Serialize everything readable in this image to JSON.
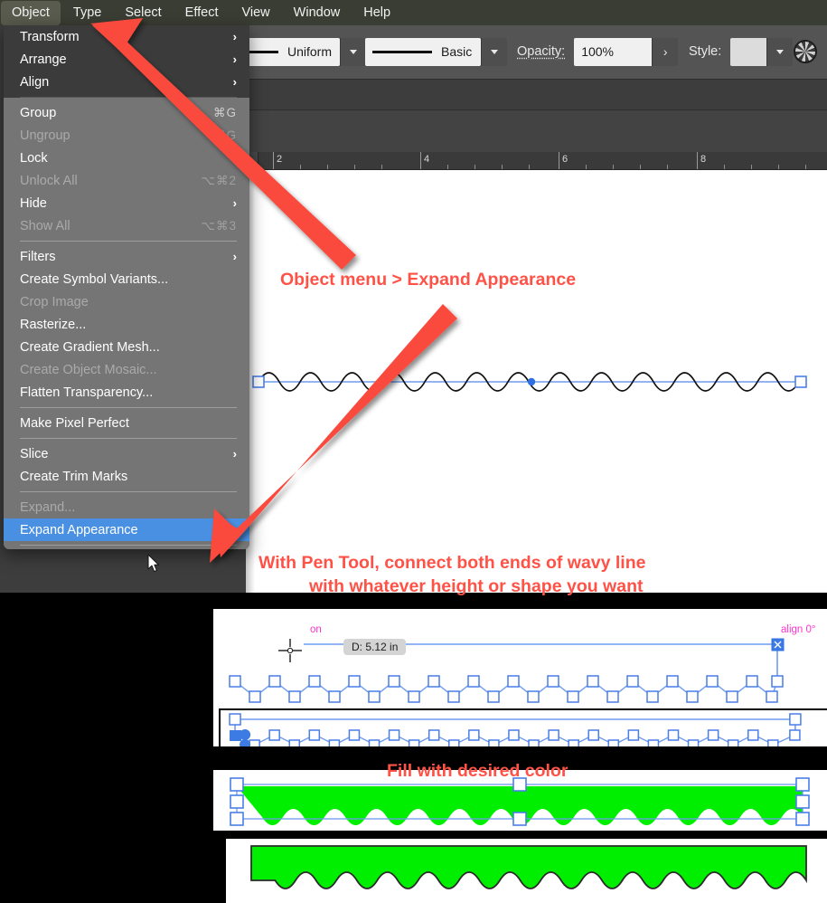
{
  "app": {
    "menubar": [
      {
        "label": "Object",
        "active": true
      },
      {
        "label": "Type",
        "active": false
      },
      {
        "label": "Select",
        "active": false
      },
      {
        "label": "Effect",
        "active": false
      },
      {
        "label": "View",
        "active": false
      },
      {
        "label": "Window",
        "active": false
      },
      {
        "label": "Help",
        "active": false
      }
    ]
  },
  "options_bar": {
    "stroke_profile": "Uniform",
    "brush_definition": "Basic",
    "opacity_label": "Opacity:",
    "opacity_value": "100%",
    "style_label": "Style:",
    "style_swatch_color": "#dcdcdc"
  },
  "ruler": {
    "unit_labels": [
      "2",
      "4",
      "6",
      "8"
    ]
  },
  "object_menu": {
    "items": [
      {
        "label": "Transform",
        "shortcut": "",
        "enabled": true,
        "submenu": true,
        "selected": false,
        "dark": true
      },
      {
        "label": "Arrange",
        "shortcut": "",
        "enabled": true,
        "submenu": true,
        "selected": false,
        "dark": true
      },
      {
        "label": "Align",
        "shortcut": "",
        "enabled": true,
        "submenu": true,
        "selected": false,
        "dark": true
      },
      {
        "separator": true,
        "dark": true
      },
      {
        "label": "Group",
        "shortcut": "⌘G",
        "enabled": true,
        "submenu": false,
        "selected": false
      },
      {
        "label": "Ungroup",
        "shortcut": "⌘G",
        "enabled": false,
        "submenu": false,
        "selected": false
      },
      {
        "label": "Lock",
        "shortcut": "",
        "enabled": true,
        "submenu": false,
        "selected": false
      },
      {
        "label": "Unlock All",
        "shortcut": "⌥⌘2",
        "enabled": false,
        "submenu": false,
        "selected": false
      },
      {
        "label": "Hide",
        "shortcut": "",
        "enabled": true,
        "submenu": true,
        "selected": false
      },
      {
        "label": "Show All",
        "shortcut": "⌥⌘3",
        "enabled": false,
        "submenu": false,
        "selected": false
      },
      {
        "separator": true
      },
      {
        "label": "Filters",
        "shortcut": "",
        "enabled": true,
        "submenu": true,
        "selected": false
      },
      {
        "label": "Create Symbol Variants...",
        "shortcut": "",
        "enabled": true,
        "submenu": false,
        "selected": false
      },
      {
        "label": "Crop Image",
        "shortcut": "",
        "enabled": false,
        "submenu": false,
        "selected": false
      },
      {
        "label": "Rasterize...",
        "shortcut": "",
        "enabled": true,
        "submenu": false,
        "selected": false
      },
      {
        "label": "Create Gradient Mesh...",
        "shortcut": "",
        "enabled": true,
        "submenu": false,
        "selected": false
      },
      {
        "label": "Create Object Mosaic...",
        "shortcut": "",
        "enabled": false,
        "submenu": false,
        "selected": false
      },
      {
        "label": "Flatten Transparency...",
        "shortcut": "",
        "enabled": true,
        "submenu": false,
        "selected": false
      },
      {
        "separator": true
      },
      {
        "label": "Make Pixel Perfect",
        "shortcut": "",
        "enabled": true,
        "submenu": false,
        "selected": false
      },
      {
        "separator": true
      },
      {
        "label": "Slice",
        "shortcut": "",
        "enabled": true,
        "submenu": true,
        "selected": false
      },
      {
        "label": "Create Trim Marks",
        "shortcut": "",
        "enabled": true,
        "submenu": false,
        "selected": false
      },
      {
        "separator": true
      },
      {
        "label": "Expand...",
        "shortcut": "",
        "enabled": false,
        "submenu": false,
        "selected": false
      },
      {
        "label": "Expand Appearance",
        "shortcut": "",
        "enabled": true,
        "submenu": false,
        "selected": true
      },
      {
        "separator": true
      }
    ],
    "highlight_color": "#4a90e2"
  },
  "annotations": {
    "color": "#ff5247",
    "step1": "Object menu > Expand Appearance",
    "step2_line1": "With Pen Tool, connect both ends of  wavy line",
    "step2_line2": "with whatever height or shape you want",
    "step3": "Fill with desired color"
  },
  "canvas_artwork": {
    "measurement_tooltip": "D: 5.12 in",
    "snap_label_on": "on",
    "snap_label_align": "align 0°",
    "smart_guide_color": "#ff00ff",
    "selection_color": "#4a7fe8",
    "fill_color": "#00ee00",
    "stroke_color": "#111111"
  }
}
